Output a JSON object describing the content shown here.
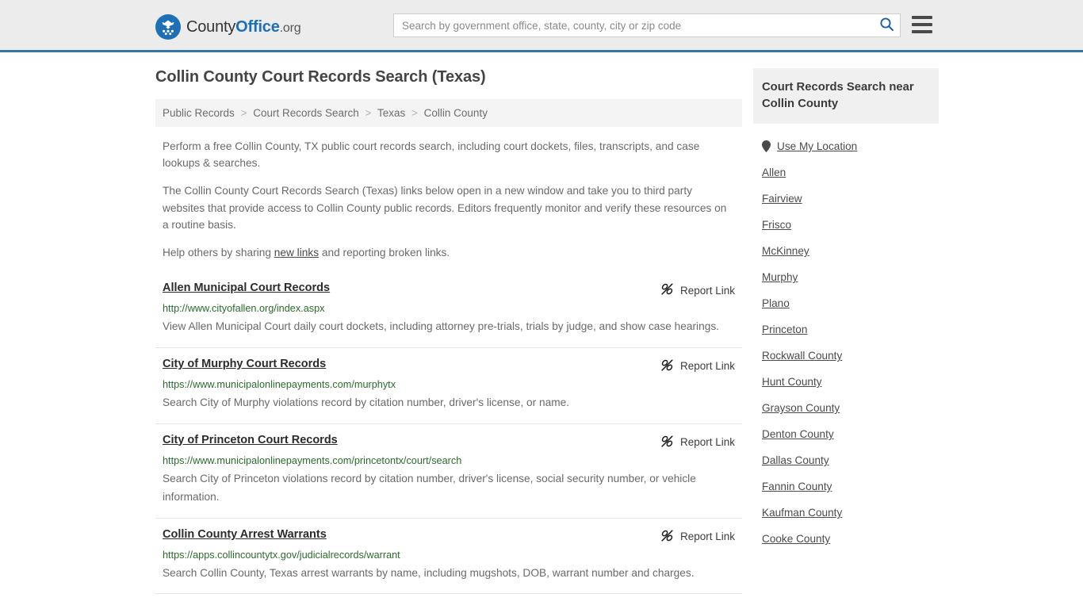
{
  "header": {
    "logo": {
      "icon": "eagle-seal-logo",
      "text_county": "County",
      "text_office": "Office",
      "text_tld": ".org"
    },
    "search": {
      "placeholder": "Search by government office, state, county, city or zip code",
      "value": "",
      "search_icon": "search-icon"
    },
    "menu_icon": "hamburger-menu-icon"
  },
  "main": {
    "title": "Collin County Court Records Search (Texas)",
    "breadcrumb": [
      "Public Records",
      "Court Records Search",
      "Texas",
      "Collin County"
    ],
    "breadcrumb_separator": ">",
    "intro": {
      "p1": "Perform a free Collin County, TX public court records search, including court dockets, files, transcripts, and case lookups & searches.",
      "p2": "The Collin County Court Records Search (Texas) links below open in a new window and take you to third party websites that provide access to Collin County public records. Editors frequently monitor and verify these resources on a routine basis.",
      "p3_before": "Help others by sharing ",
      "p3_link": "new links",
      "p3_after": " and reporting broken links."
    },
    "report_link_label": "Report Link",
    "report_link_icon": "broken-link-icon",
    "links": [
      {
        "title": "Allen Municipal Court Records",
        "url": "http://www.cityofallen.org/index.aspx",
        "description": "View Allen Municipal Court daily court dockets, including attorney pre-trials, trials by judge, and show case hearings."
      },
      {
        "title": "City of Murphy Court Records",
        "url": "https://www.municipalonlinepayments.com/murphytx",
        "description": "Search City of Murphy violations record by citation number, driver's license, or name."
      },
      {
        "title": "City of Princeton Court Records",
        "url": "https://www.municipalonlinepayments.com/princetontx/court/search",
        "description": "Search City of Princeton violations record by citation number, driver's license, social security number, or vehicle information."
      },
      {
        "title": "Collin County Arrest Warrants",
        "url": "https://apps.collincountytx.gov/judicialrecords/warrant",
        "description": "Search Collin County, Texas arrest warrants by name, including mugshots, DOB, warrant number and charges."
      }
    ]
  },
  "sidebar": {
    "heading": "Court Records Search near Collin County",
    "use_my_location": {
      "label": "Use My Location",
      "icon": "map-pin-icon"
    },
    "items": [
      {
        "label": "Allen"
      },
      {
        "label": "Fairview"
      },
      {
        "label": "Frisco"
      },
      {
        "label": "McKinney"
      },
      {
        "label": "Murphy"
      },
      {
        "label": "Plano"
      },
      {
        "label": "Princeton"
      },
      {
        "label": "Rockwall County"
      },
      {
        "label": "Hunt County"
      },
      {
        "label": "Grayson County"
      },
      {
        "label": "Denton County"
      },
      {
        "label": "Dallas County"
      },
      {
        "label": "Fannin County"
      },
      {
        "label": "Kaufman County"
      },
      {
        "label": "Cooke County"
      }
    ]
  },
  "colors": {
    "header_bg": "#ececec",
    "header_border": "#3b72a6",
    "brand_blue": "#1f6fb5",
    "url_green": "#2d6b2d",
    "breadcrumb_bg": "#f4f4f4",
    "sidebar_head_bg": "#f0f0f0",
    "body_text": "#6a6a6a"
  }
}
